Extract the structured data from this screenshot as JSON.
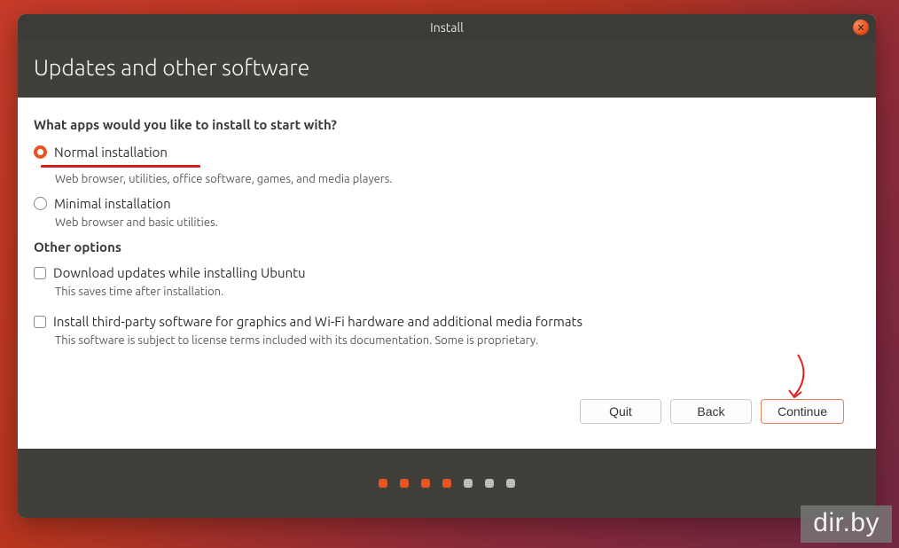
{
  "titlebar": {
    "title": "Install"
  },
  "header": {
    "title": "Updates and other software"
  },
  "question": "What apps would you like to install to start with?",
  "install_options": [
    {
      "label": "Normal installation",
      "desc": "Web browser, utilities, office software, games, and media players.",
      "selected": true
    },
    {
      "label": "Minimal installation",
      "desc": "Web browser and basic utilities.",
      "selected": false
    }
  ],
  "other_title": "Other options",
  "other_options": [
    {
      "label": "Download updates while installing Ubuntu",
      "desc": "This saves time after installation.",
      "checked": false
    },
    {
      "label": "Install third-party software for graphics and Wi-Fi hardware and additional media formats",
      "desc": "This software is subject to license terms included with its documentation. Some is proprietary.",
      "checked": false
    }
  ],
  "buttons": {
    "quit": "Quit",
    "back": "Back",
    "continue": "Continue"
  },
  "progress": {
    "total": 7,
    "active": 4
  },
  "watermark": "dir.by",
  "colors": {
    "accent": "#e95420",
    "underline": "#d42020"
  }
}
